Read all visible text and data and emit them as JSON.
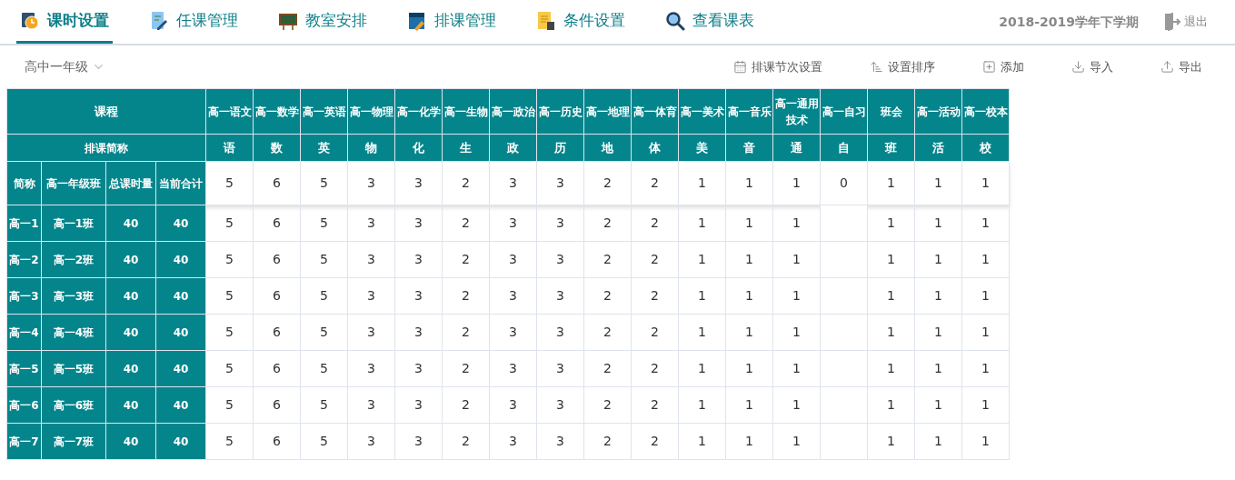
{
  "tabs": [
    {
      "label": "课时设置",
      "selected": true
    },
    {
      "label": "任课管理",
      "selected": false
    },
    {
      "label": "教室安排",
      "selected": false
    },
    {
      "label": "排课管理",
      "selected": false
    },
    {
      "label": "条件设置",
      "selected": false
    },
    {
      "label": "查看课表",
      "selected": false
    }
  ],
  "term": "2018-2019学年下学期",
  "logout": "退出",
  "grade_select": "高中一年级",
  "actions": [
    "排课节次设置",
    "设置排序",
    "添加",
    "导入",
    "导出"
  ],
  "table": {
    "course_header": "课程",
    "short_header": "排课简称",
    "class_columns": [
      "简称",
      "高一年级班",
      "总课时量",
      "当前合计"
    ],
    "subjects": [
      {
        "name": "高一语文",
        "short": "语",
        "planned": "5"
      },
      {
        "name": "高一数学",
        "short": "数",
        "planned": "6"
      },
      {
        "name": "高一英语",
        "short": "英",
        "planned": "5"
      },
      {
        "name": "高一物理",
        "short": "物",
        "planned": "3"
      },
      {
        "name": "高一化学",
        "short": "化",
        "planned": "3"
      },
      {
        "name": "高一生物",
        "short": "生",
        "planned": "2"
      },
      {
        "name": "高一政治",
        "short": "政",
        "planned": "3"
      },
      {
        "name": "高一历史",
        "short": "历",
        "planned": "3"
      },
      {
        "name": "高一地理",
        "short": "地",
        "planned": "2"
      },
      {
        "name": "高一体育",
        "short": "体",
        "planned": "2"
      },
      {
        "name": "高一美术",
        "short": "美",
        "planned": "1"
      },
      {
        "name": "高一音乐",
        "short": "音",
        "planned": "1"
      },
      {
        "name": "高一通用技术",
        "short": "通",
        "planned": "1"
      },
      {
        "name": "高一自习",
        "short": "自",
        "planned": "0"
      },
      {
        "name": "班会",
        "short": "班",
        "planned": "1"
      },
      {
        "name": "高一活动",
        "short": "活",
        "planned": "1"
      },
      {
        "name": "高一校本",
        "short": "校",
        "planned": "1"
      }
    ],
    "rows": [
      {
        "short": "高一1",
        "name": "高一1班",
        "total": "40",
        "current": "40",
        "cells": [
          {
            "value": "5"
          },
          {
            "value": "6"
          },
          {
            "value": "5"
          },
          {
            "value": "3"
          },
          {
            "value": "3"
          },
          {
            "value": "2"
          },
          {
            "value": "3"
          },
          {
            "value": "3"
          },
          {
            "value": "2"
          },
          {
            "value": "2"
          },
          {
            "value": "1"
          },
          {
            "value": "1"
          },
          {
            "value": "1"
          },
          {},
          {
            "value": "1"
          },
          {
            "value": "1"
          },
          {
            "value": "1"
          }
        ]
      },
      {
        "short": "高一2",
        "name": "高一2班",
        "total": "40",
        "current": "40",
        "cells": [
          {
            "value": "5"
          },
          {
            "value": "6"
          },
          {
            "value": "5"
          },
          {
            "value": "3"
          },
          {
            "value": "3"
          },
          {
            "value": "2"
          },
          {
            "value": "3"
          },
          {
            "value": "3"
          },
          {
            "value": "2"
          },
          {
            "value": "2"
          },
          {
            "value": "1"
          },
          {
            "value": "1"
          },
          {
            "value": "1"
          },
          {},
          {
            "value": "1"
          },
          {
            "value": "1"
          },
          {
            "value": "1"
          }
        ]
      },
      {
        "short": "高一3",
        "name": "高一3班",
        "total": "40",
        "current": "40",
        "cells": [
          {
            "value": "5"
          },
          {
            "value": "6"
          },
          {
            "value": "5"
          },
          {
            "value": "3"
          },
          {
            "value": "3"
          },
          {
            "value": "2"
          },
          {
            "value": "3"
          },
          {
            "value": "3"
          },
          {
            "value": "2"
          },
          {
            "value": "2"
          },
          {
            "value": "1"
          },
          {
            "value": "1"
          },
          {
            "value": "1"
          },
          {},
          {
            "value": "1"
          },
          {
            "value": "1"
          },
          {
            "value": "1"
          }
        ]
      },
      {
        "short": "高一4",
        "name": "高一4班",
        "total": "40",
        "current": "40",
        "cells": [
          {
            "value": "5"
          },
          {
            "value": "6"
          },
          {
            "value": "5"
          },
          {
            "value": "3"
          },
          {
            "value": "3"
          },
          {
            "value": "2"
          },
          {
            "value": "3"
          },
          {
            "value": "3"
          },
          {
            "value": "2"
          },
          {
            "value": "2"
          },
          {
            "value": "1"
          },
          {
            "value": "1"
          },
          {
            "value": "1"
          },
          {},
          {
            "value": "1"
          },
          {
            "value": "1"
          },
          {
            "value": "1"
          }
        ]
      },
      {
        "short": "高一5",
        "name": "高一5班",
        "total": "40",
        "current": "40",
        "cells": [
          {
            "value": "5"
          },
          {
            "value": "6"
          },
          {
            "value": "5"
          },
          {
            "value": "3"
          },
          {
            "value": "3"
          },
          {
            "value": "2"
          },
          {
            "value": "3"
          },
          {
            "value": "3"
          },
          {
            "value": "2"
          },
          {
            "value": "2"
          },
          {
            "value": "1"
          },
          {
            "value": "1"
          },
          {
            "value": "1"
          },
          {},
          {
            "value": "1"
          },
          {
            "value": "1"
          },
          {
            "value": "1"
          }
        ]
      },
      {
        "short": "高一6",
        "name": "高一6班",
        "total": "40",
        "current": "40",
        "cells": [
          {
            "value": "5"
          },
          {
            "value": "6"
          },
          {
            "value": "5"
          },
          {
            "value": "3"
          },
          {
            "value": "3"
          },
          {
            "value": "2"
          },
          {
            "value": "3"
          },
          {
            "value": "3"
          },
          {
            "value": "2"
          },
          {
            "value": "2"
          },
          {
            "value": "1"
          },
          {
            "value": "1"
          },
          {
            "value": "1"
          },
          {},
          {
            "value": "1"
          },
          {
            "value": "1"
          },
          {
            "value": "1"
          }
        ]
      },
      {
        "short": "高一7",
        "name": "高一7班",
        "total": "40",
        "current": "40",
        "cells": [
          {
            "value": "5"
          },
          {
            "value": "6"
          },
          {
            "value": "5"
          },
          {
            "value": "3"
          },
          {
            "value": "3"
          },
          {
            "value": "2"
          },
          {
            "value": "3"
          },
          {
            "value": "3"
          },
          {
            "value": "2"
          },
          {
            "value": "2"
          },
          {
            "value": "1"
          },
          {
            "value": "1"
          },
          {
            "value": "1"
          },
          {},
          {
            "value": "1"
          },
          {
            "value": "1"
          },
          {
            "value": "1"
          }
        ]
      }
    ]
  }
}
